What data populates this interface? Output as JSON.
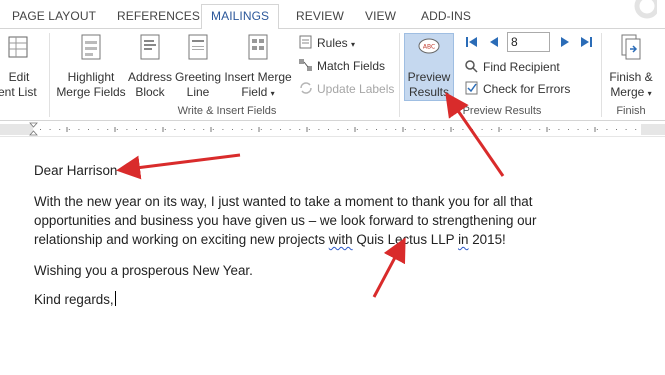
{
  "tabs": [
    {
      "label": "PAGE LAYOUT"
    },
    {
      "label": "REFERENCES"
    },
    {
      "label": "MAILINGS",
      "active": true
    },
    {
      "label": "REVIEW"
    },
    {
      "label": "VIEW"
    },
    {
      "label": "ADD-INS"
    }
  ],
  "ribbon": {
    "edit_list": {
      "line1": "Edit",
      "line2": "ient List"
    },
    "write_insert": {
      "highlight": {
        "line1": "Highlight",
        "line2": "Merge Fields"
      },
      "address": {
        "line1": "Address",
        "line2": "Block"
      },
      "greeting": {
        "line1": "Greeting",
        "line2": "Line"
      },
      "insert_merge": {
        "line1": "Insert Merge",
        "line2": "Field"
      },
      "rules": "Rules",
      "match_fields": "Match Fields",
      "update_labels": "Update Labels",
      "group_label": "Write & Insert Fields"
    },
    "preview": {
      "button": {
        "line1": "Preview",
        "line2": "Results"
      },
      "record_number": "8",
      "find_recipient": "Find Recipient",
      "check_errors": "Check for Errors",
      "group_label": "Preview Results"
    },
    "finish": {
      "button": {
        "line1": "Finish &",
        "line2": "Merge"
      },
      "group_label": "Finish"
    }
  },
  "document": {
    "greeting": "Dear Harrison",
    "body_line1": "With the new year on its way, I just wanted to take a moment to thank you for all that",
    "body_line2": "opportunities and business you have given us – we look forward to strengthening our",
    "body_line3_before": "relationship and working on exciting new projects ",
    "body_line3_with": "with",
    "body_line3_space": " ",
    "body_line3_company": "Quis Lectus LLP",
    "body_line3_space2": " ",
    "body_line3_in": "in",
    "body_line3_after": " 2015!",
    "wishing": "Wishing you a prosperous New Year.",
    "closing": "Kind regards,"
  },
  "colors": {
    "accent": "#2b579a",
    "arrow": "#d92b2b",
    "preview_highlight": "#c5d8ef"
  }
}
